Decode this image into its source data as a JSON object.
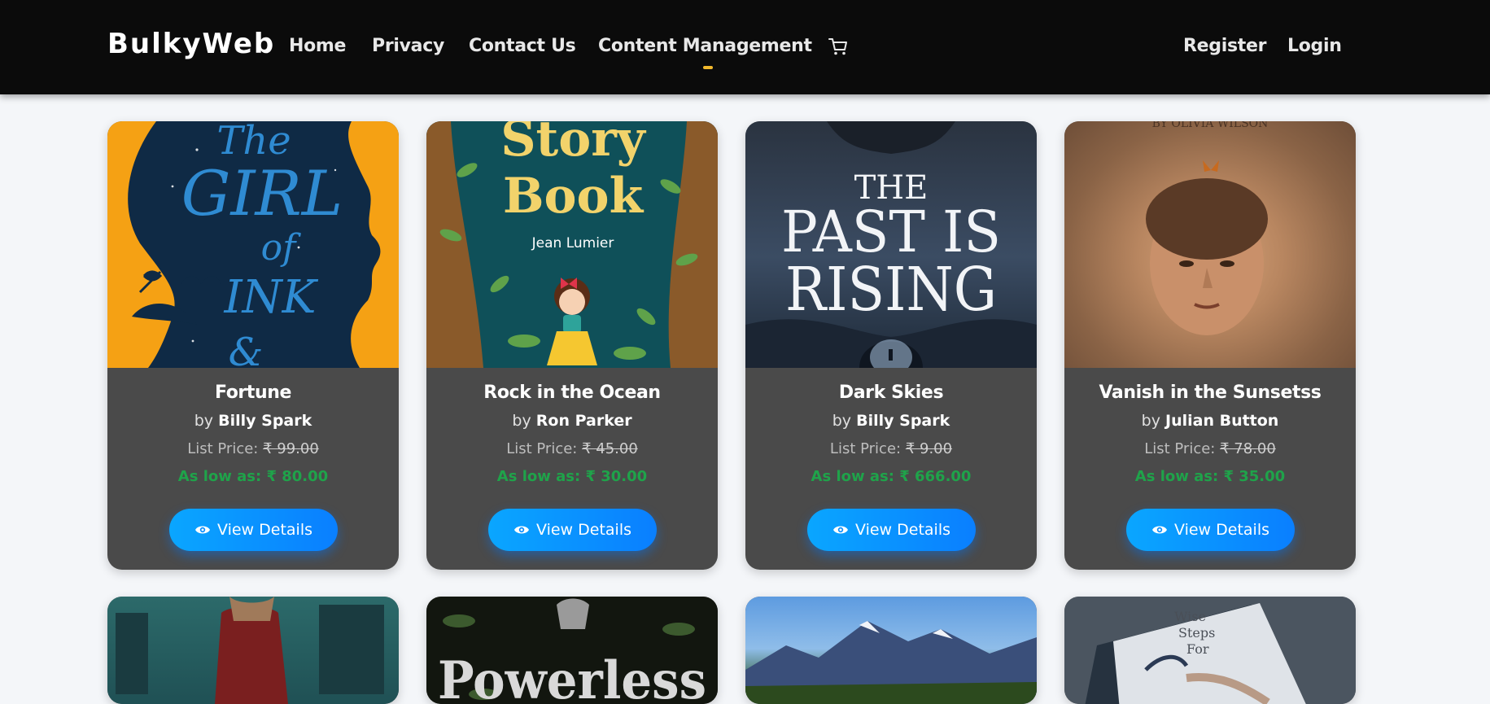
{
  "nav": {
    "brand": "BulkyWeb",
    "links": [
      "Home",
      "Privacy",
      "Contact Us",
      "Content Management"
    ],
    "register": "Register",
    "login": "Login"
  },
  "currency_prefix_list": "List Price: ",
  "currency_prefix_low": "As low as: ",
  "by_label": "by",
  "button_label": "View Details",
  "products": [
    {
      "title": "Fortune",
      "author": "Billy Spark",
      "list_price": "₹ 99.00",
      "low_price": "₹ 80.00",
      "cover_text": [
        "The",
        "GIRL",
        "of",
        "INK",
        "&"
      ]
    },
    {
      "title": "Rock in the Ocean",
      "author": "Ron Parker",
      "list_price": "₹ 45.00",
      "low_price": "₹ 30.00",
      "cover_text": [
        "Story",
        "Book",
        "Jean Lumier"
      ]
    },
    {
      "title": "Dark Skies",
      "author": "Billy Spark",
      "list_price": "₹ 9.00",
      "low_price": "₹ 666.00",
      "cover_text": [
        "THE",
        "PAST IS",
        "RISING"
      ]
    },
    {
      "title": "Vanish in the Sunsetss",
      "author": "Julian Button",
      "list_price": "₹ 78.00",
      "low_price": "₹ 35.00",
      "cover_text": [
        "BY OLIVIA WILSON"
      ]
    }
  ],
  "second_row_covers": [
    {
      "cover_text": []
    },
    {
      "cover_text": [
        "Powerless"
      ]
    },
    {
      "cover_text": []
    },
    {
      "cover_text": [
        "Wise",
        "Steps",
        "For"
      ]
    }
  ],
  "colors": {
    "navbar": "#0b0b0b",
    "accent": "#f1b82d",
    "card_body": "#4a4a4a",
    "button": "#0a8fff",
    "low_price": "#1fa34a"
  }
}
